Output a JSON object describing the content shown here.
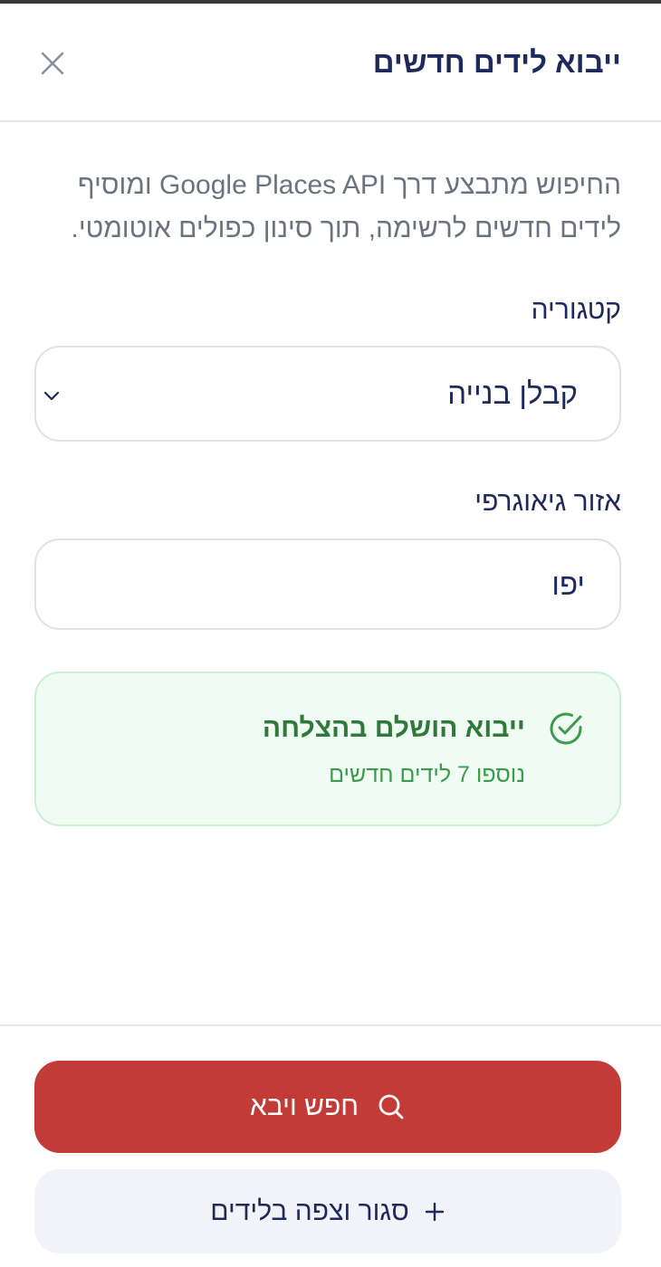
{
  "dialog": {
    "title": "ייבוא לידים חדשים",
    "close_icon": "close-icon",
    "description": "החיפוש מתבצע דרך Google Places API ומוסיף לידים חדשים לרשימה, תוך סינון כפולים אוטומטי."
  },
  "form": {
    "category": {
      "label": "קטגוריה",
      "value": "קבלן בנייה",
      "icon": "chevron-down-icon"
    },
    "region": {
      "label": "אזור גיאוגרפי",
      "value": "יפו"
    }
  },
  "status": {
    "title": "ייבוא הושלם בהצלחה",
    "message": "נוספו 7 לידים חדשים",
    "icon": "check-circle-icon",
    "color": "#2f7a3b"
  },
  "actions": {
    "primary": {
      "label": "חפש ויבא",
      "icon": "search-icon",
      "color": "#c23b36"
    },
    "secondary": {
      "label": "סגור וצפה בלידים",
      "icon": "plus-icon"
    }
  },
  "colors": {
    "text_primary": "#1f2a5c",
    "text_muted": "#6b7280",
    "success_bg": "#f0fbf3",
    "secondary_bg": "#f1f3f9"
  }
}
